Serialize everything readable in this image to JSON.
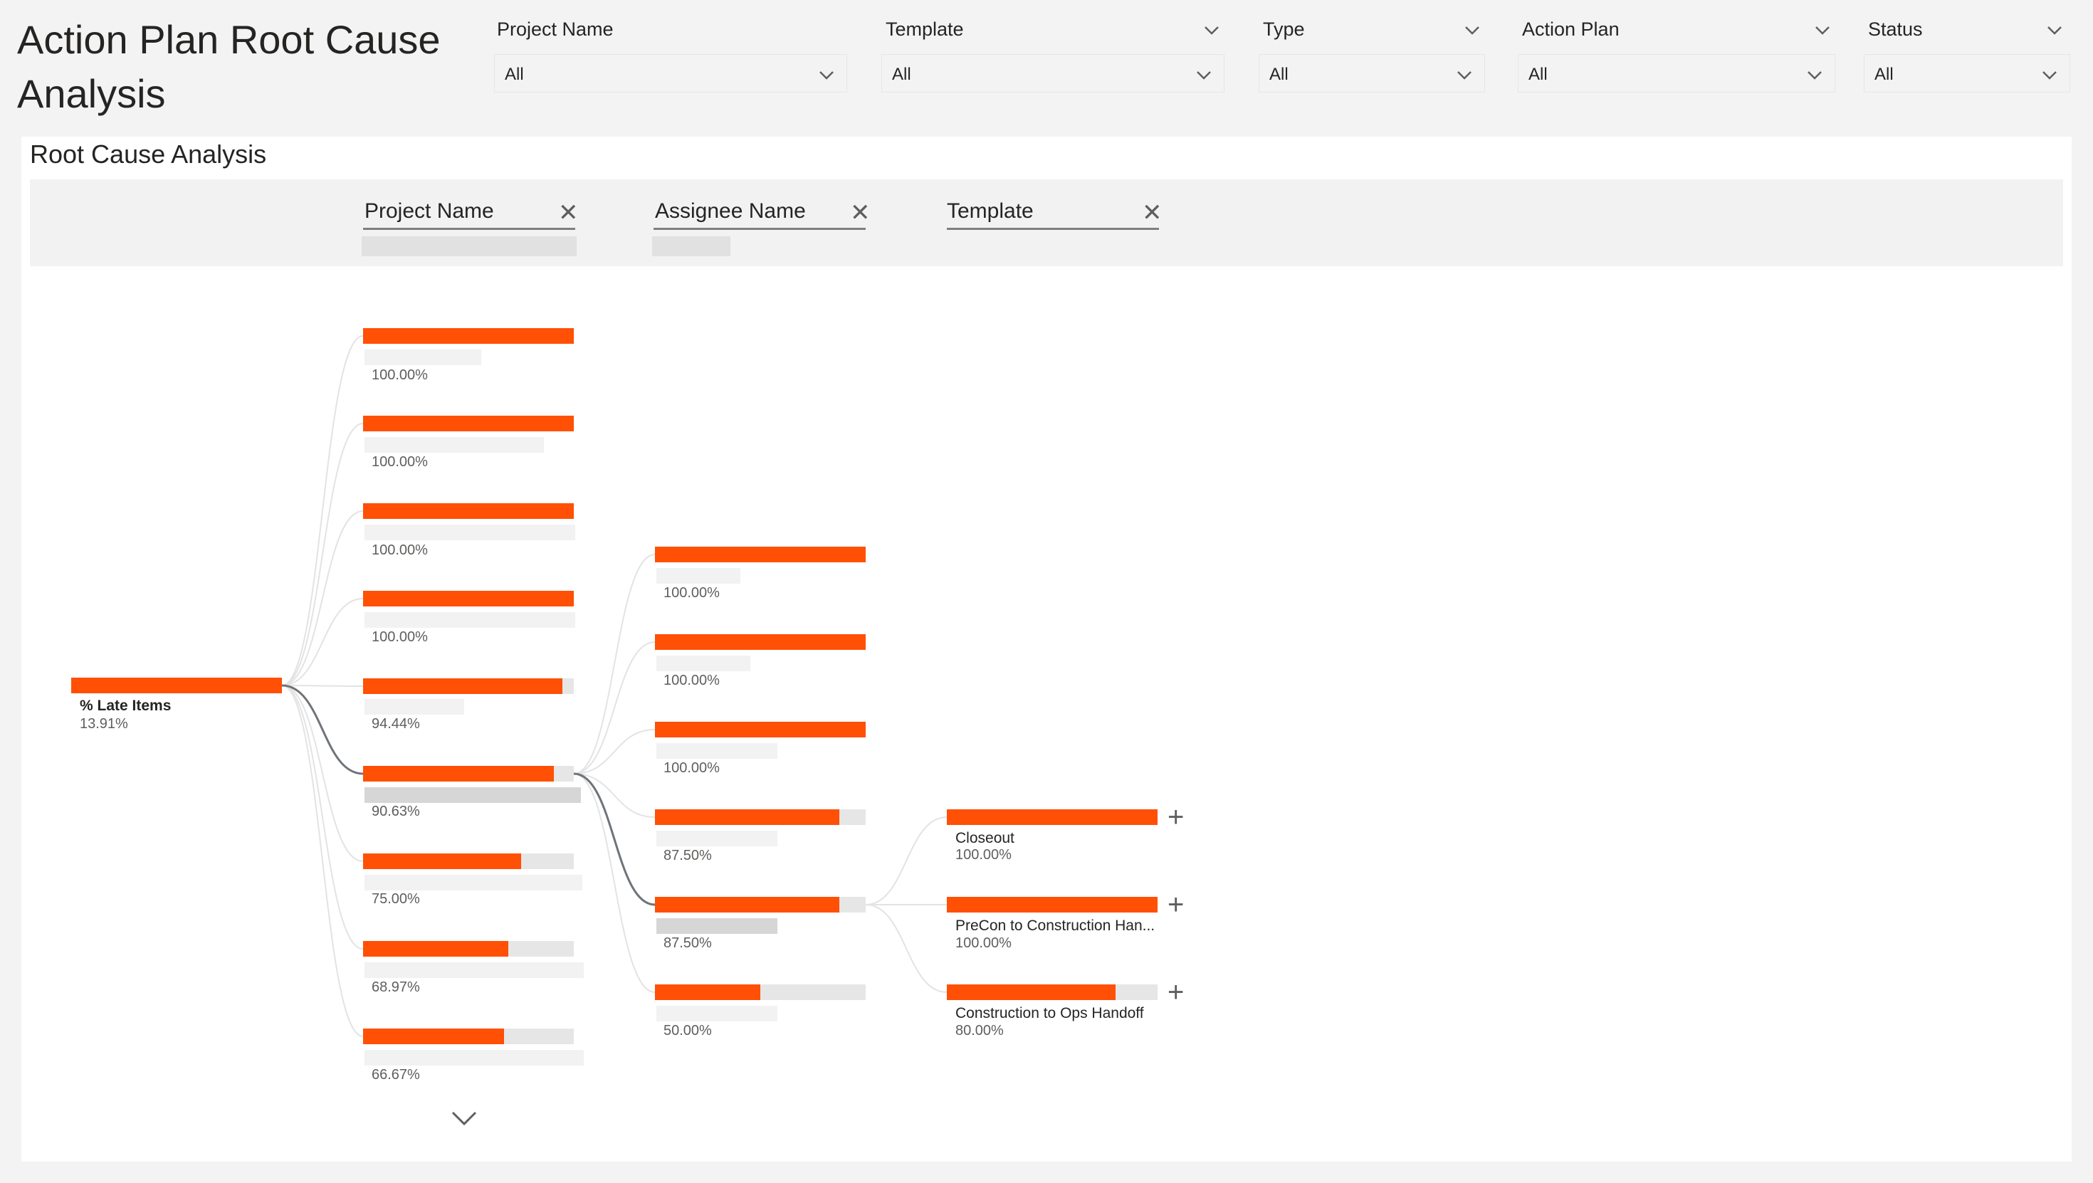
{
  "page": {
    "title": "Action Plan Root Cause Analysis"
  },
  "slicers": [
    {
      "label": "Project Name",
      "value": "All"
    },
    {
      "label": "Template",
      "value": "All"
    },
    {
      "label": "Type",
      "value": "All"
    },
    {
      "label": "Action Plan",
      "value": "All"
    },
    {
      "label": "Status",
      "value": "All"
    }
  ],
  "visual": {
    "title": "Root Cause Analysis",
    "levels": [
      {
        "title": "Project Name"
      },
      {
        "title": "Assignee Name"
      },
      {
        "title": "Template"
      }
    ],
    "root": {
      "label": "% Late Items",
      "value": "13.91%",
      "fraction": 1.0
    },
    "level1": [
      {
        "value": "100.00%",
        "fraction": 1.0
      },
      {
        "value": "100.00%",
        "fraction": 1.0
      },
      {
        "value": "100.00%",
        "fraction": 1.0
      },
      {
        "value": "100.00%",
        "fraction": 1.0
      },
      {
        "value": "94.44%",
        "fraction": 0.9444
      },
      {
        "value": "90.63%",
        "fraction": 0.9063,
        "selected": true
      },
      {
        "value": "75.00%",
        "fraction": 0.75
      },
      {
        "value": "68.97%",
        "fraction": 0.6897
      },
      {
        "value": "66.67%",
        "fraction": 0.6667
      }
    ],
    "level2": [
      {
        "value": "100.00%",
        "fraction": 1.0
      },
      {
        "value": "100.00%",
        "fraction": 1.0
      },
      {
        "value": "100.00%",
        "fraction": 1.0
      },
      {
        "value": "87.50%",
        "fraction": 0.875
      },
      {
        "value": "87.50%",
        "fraction": 0.875,
        "selected": true
      },
      {
        "value": "50.00%",
        "fraction": 0.5
      }
    ],
    "level3": [
      {
        "label": "Closeout",
        "value": "100.00%",
        "fraction": 1.0
      },
      {
        "label": "PreCon to Construction Han...",
        "value": "100.00%",
        "fraction": 1.0
      },
      {
        "label": "Construction to Ops Handoff",
        "value": "80.00%",
        "fraction": 0.8
      }
    ],
    "expand_icon": "plus-icon",
    "more_icon": "chevron-down-icon"
  },
  "colors": {
    "bar": "#ff5005",
    "track": "#e6e6e6",
    "selected_line": "#6f7479",
    "line": "#e3e3e3"
  }
}
